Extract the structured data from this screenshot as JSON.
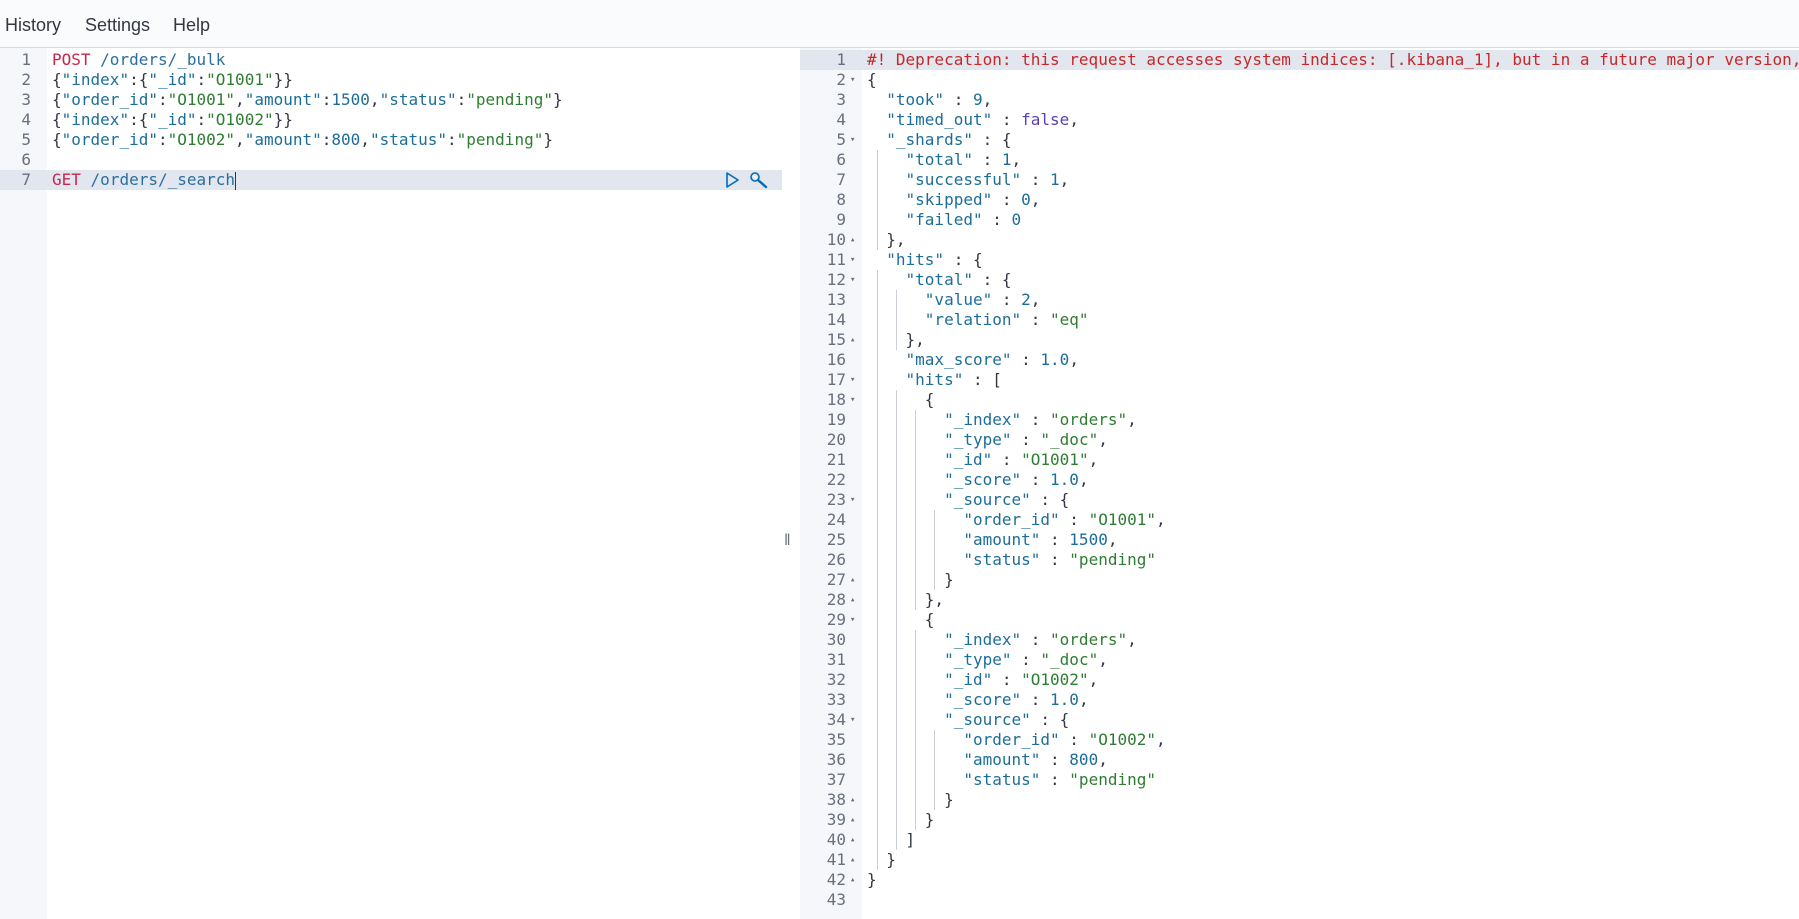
{
  "menu": {
    "history": "History",
    "settings": "Settings",
    "help": "Help"
  },
  "request_editor": {
    "lines": [
      {
        "n": "1",
        "tokens": [
          {
            "t": "POST",
            "c": "method"
          },
          {
            "t": " ",
            "c": "punc"
          },
          {
            "t": "/orders/_bulk",
            "c": "url"
          }
        ]
      },
      {
        "n": "2",
        "tokens": [
          {
            "t": "{",
            "c": "punc"
          },
          {
            "t": "\"index\"",
            "c": "key"
          },
          {
            "t": ":{",
            "c": "punc"
          },
          {
            "t": "\"_id\"",
            "c": "key"
          },
          {
            "t": ":",
            "c": "punc"
          },
          {
            "t": "\"O1001\"",
            "c": "str"
          },
          {
            "t": "}}",
            "c": "punc"
          }
        ]
      },
      {
        "n": "3",
        "tokens": [
          {
            "t": "{",
            "c": "punc"
          },
          {
            "t": "\"order_id\"",
            "c": "key"
          },
          {
            "t": ":",
            "c": "punc"
          },
          {
            "t": "\"O1001\"",
            "c": "str"
          },
          {
            "t": ",",
            "c": "punc"
          },
          {
            "t": "\"amount\"",
            "c": "key"
          },
          {
            "t": ":",
            "c": "punc"
          },
          {
            "t": "1500",
            "c": "num"
          },
          {
            "t": ",",
            "c": "punc"
          },
          {
            "t": "\"status\"",
            "c": "key"
          },
          {
            "t": ":",
            "c": "punc"
          },
          {
            "t": "\"pending\"",
            "c": "str"
          },
          {
            "t": "}",
            "c": "punc"
          }
        ]
      },
      {
        "n": "4",
        "tokens": [
          {
            "t": "{",
            "c": "punc"
          },
          {
            "t": "\"index\"",
            "c": "key"
          },
          {
            "t": ":{",
            "c": "punc"
          },
          {
            "t": "\"_id\"",
            "c": "key"
          },
          {
            "t": ":",
            "c": "punc"
          },
          {
            "t": "\"O1002\"",
            "c": "str"
          },
          {
            "t": "}}",
            "c": "punc"
          }
        ]
      },
      {
        "n": "5",
        "tokens": [
          {
            "t": "{",
            "c": "punc"
          },
          {
            "t": "\"order_id\"",
            "c": "key"
          },
          {
            "t": ":",
            "c": "punc"
          },
          {
            "t": "\"O1002\"",
            "c": "str"
          },
          {
            "t": ",",
            "c": "punc"
          },
          {
            "t": "\"amount\"",
            "c": "key"
          },
          {
            "t": ":",
            "c": "punc"
          },
          {
            "t": "800",
            "c": "num"
          },
          {
            "t": ",",
            "c": "punc"
          },
          {
            "t": "\"status\"",
            "c": "key"
          },
          {
            "t": ":",
            "c": "punc"
          },
          {
            "t": "\"pending\"",
            "c": "str"
          },
          {
            "t": "}",
            "c": "punc"
          }
        ]
      },
      {
        "n": "6",
        "tokens": []
      },
      {
        "n": "7",
        "tokens": [
          {
            "t": "GET",
            "c": "method"
          },
          {
            "t": " ",
            "c": "punc"
          },
          {
            "t": "/orders/_search",
            "c": "url"
          }
        ]
      }
    ],
    "active_line": "7",
    "actions": {
      "run_icon": "play-icon",
      "settings_icon": "wrench-icon"
    }
  },
  "response_viewer": {
    "lines": [
      {
        "n": "1",
        "fold": "",
        "tokens": [
          {
            "t": "#! Deprecation: this request accesses system indices: [.kibana_1], but in a future major version,",
            "c": "comment"
          }
        ]
      },
      {
        "n": "2",
        "fold": "▾",
        "tokens": [
          {
            "t": "{",
            "c": "punc"
          }
        ]
      },
      {
        "n": "3",
        "fold": "",
        "tokens": [
          {
            "t": "  ",
            "c": "punc"
          },
          {
            "t": "\"took\"",
            "c": "key"
          },
          {
            "t": " : ",
            "c": "punc"
          },
          {
            "t": "9",
            "c": "num"
          },
          {
            "t": ",",
            "c": "punc"
          }
        ]
      },
      {
        "n": "4",
        "fold": "",
        "tokens": [
          {
            "t": "  ",
            "c": "punc"
          },
          {
            "t": "\"timed_out\"",
            "c": "key"
          },
          {
            "t": " : ",
            "c": "punc"
          },
          {
            "t": "false",
            "c": "bool"
          },
          {
            "t": ",",
            "c": "punc"
          }
        ]
      },
      {
        "n": "5",
        "fold": "▾",
        "tokens": [
          {
            "t": "  ",
            "c": "punc"
          },
          {
            "t": "\"_shards\"",
            "c": "key"
          },
          {
            "t": " : {",
            "c": "punc"
          }
        ]
      },
      {
        "n": "6",
        "fold": "",
        "tokens": [
          {
            "t": "    ",
            "c": "punc"
          },
          {
            "t": "\"total\"",
            "c": "key"
          },
          {
            "t": " : ",
            "c": "punc"
          },
          {
            "t": "1",
            "c": "num"
          },
          {
            "t": ",",
            "c": "punc"
          }
        ]
      },
      {
        "n": "7",
        "fold": "",
        "tokens": [
          {
            "t": "    ",
            "c": "punc"
          },
          {
            "t": "\"successful\"",
            "c": "key"
          },
          {
            "t": " : ",
            "c": "punc"
          },
          {
            "t": "1",
            "c": "num"
          },
          {
            "t": ",",
            "c": "punc"
          }
        ]
      },
      {
        "n": "8",
        "fold": "",
        "tokens": [
          {
            "t": "    ",
            "c": "punc"
          },
          {
            "t": "\"skipped\"",
            "c": "key"
          },
          {
            "t": " : ",
            "c": "punc"
          },
          {
            "t": "0",
            "c": "num"
          },
          {
            "t": ",",
            "c": "punc"
          }
        ]
      },
      {
        "n": "9",
        "fold": "",
        "tokens": [
          {
            "t": "    ",
            "c": "punc"
          },
          {
            "t": "\"failed\"",
            "c": "key"
          },
          {
            "t": " : ",
            "c": "punc"
          },
          {
            "t": "0",
            "c": "num"
          }
        ]
      },
      {
        "n": "10",
        "fold": "▴",
        "tokens": [
          {
            "t": "  },",
            "c": "punc"
          }
        ]
      },
      {
        "n": "11",
        "fold": "▾",
        "tokens": [
          {
            "t": "  ",
            "c": "punc"
          },
          {
            "t": "\"hits\"",
            "c": "key"
          },
          {
            "t": " : {",
            "c": "punc"
          }
        ]
      },
      {
        "n": "12",
        "fold": "▾",
        "tokens": [
          {
            "t": "    ",
            "c": "punc"
          },
          {
            "t": "\"total\"",
            "c": "key"
          },
          {
            "t": " : {",
            "c": "punc"
          }
        ]
      },
      {
        "n": "13",
        "fold": "",
        "tokens": [
          {
            "t": "      ",
            "c": "punc"
          },
          {
            "t": "\"value\"",
            "c": "key"
          },
          {
            "t": " : ",
            "c": "punc"
          },
          {
            "t": "2",
            "c": "num"
          },
          {
            "t": ",",
            "c": "punc"
          }
        ]
      },
      {
        "n": "14",
        "fold": "",
        "tokens": [
          {
            "t": "      ",
            "c": "punc"
          },
          {
            "t": "\"relation\"",
            "c": "key"
          },
          {
            "t": " : ",
            "c": "punc"
          },
          {
            "t": "\"eq\"",
            "c": "str"
          }
        ]
      },
      {
        "n": "15",
        "fold": "▴",
        "tokens": [
          {
            "t": "    },",
            "c": "punc"
          }
        ]
      },
      {
        "n": "16",
        "fold": "",
        "tokens": [
          {
            "t": "    ",
            "c": "punc"
          },
          {
            "t": "\"max_score\"",
            "c": "key"
          },
          {
            "t": " : ",
            "c": "punc"
          },
          {
            "t": "1.0",
            "c": "num"
          },
          {
            "t": ",",
            "c": "punc"
          }
        ]
      },
      {
        "n": "17",
        "fold": "▾",
        "tokens": [
          {
            "t": "    ",
            "c": "punc"
          },
          {
            "t": "\"hits\"",
            "c": "key"
          },
          {
            "t": " : [",
            "c": "punc"
          }
        ]
      },
      {
        "n": "18",
        "fold": "▾",
        "tokens": [
          {
            "t": "      {",
            "c": "punc"
          }
        ]
      },
      {
        "n": "19",
        "fold": "",
        "tokens": [
          {
            "t": "        ",
            "c": "punc"
          },
          {
            "t": "\"_index\"",
            "c": "key"
          },
          {
            "t": " : ",
            "c": "punc"
          },
          {
            "t": "\"orders\"",
            "c": "str"
          },
          {
            "t": ",",
            "c": "punc"
          }
        ]
      },
      {
        "n": "20",
        "fold": "",
        "tokens": [
          {
            "t": "        ",
            "c": "punc"
          },
          {
            "t": "\"_type\"",
            "c": "key"
          },
          {
            "t": " : ",
            "c": "punc"
          },
          {
            "t": "\"_doc\"",
            "c": "str"
          },
          {
            "t": ",",
            "c": "punc"
          }
        ]
      },
      {
        "n": "21",
        "fold": "",
        "tokens": [
          {
            "t": "        ",
            "c": "punc"
          },
          {
            "t": "\"_id\"",
            "c": "key"
          },
          {
            "t": " : ",
            "c": "punc"
          },
          {
            "t": "\"O1001\"",
            "c": "str"
          },
          {
            "t": ",",
            "c": "punc"
          }
        ]
      },
      {
        "n": "22",
        "fold": "",
        "tokens": [
          {
            "t": "        ",
            "c": "punc"
          },
          {
            "t": "\"_score\"",
            "c": "key"
          },
          {
            "t": " : ",
            "c": "punc"
          },
          {
            "t": "1.0",
            "c": "num"
          },
          {
            "t": ",",
            "c": "punc"
          }
        ]
      },
      {
        "n": "23",
        "fold": "▾",
        "tokens": [
          {
            "t": "        ",
            "c": "punc"
          },
          {
            "t": "\"_source\"",
            "c": "key"
          },
          {
            "t": " : {",
            "c": "punc"
          }
        ]
      },
      {
        "n": "24",
        "fold": "",
        "tokens": [
          {
            "t": "          ",
            "c": "punc"
          },
          {
            "t": "\"order_id\"",
            "c": "key"
          },
          {
            "t": " : ",
            "c": "punc"
          },
          {
            "t": "\"O1001\"",
            "c": "str"
          },
          {
            "t": ",",
            "c": "punc"
          }
        ]
      },
      {
        "n": "25",
        "fold": "",
        "tokens": [
          {
            "t": "          ",
            "c": "punc"
          },
          {
            "t": "\"amount\"",
            "c": "key"
          },
          {
            "t": " : ",
            "c": "punc"
          },
          {
            "t": "1500",
            "c": "num"
          },
          {
            "t": ",",
            "c": "punc"
          }
        ]
      },
      {
        "n": "26",
        "fold": "",
        "tokens": [
          {
            "t": "          ",
            "c": "punc"
          },
          {
            "t": "\"status\"",
            "c": "key"
          },
          {
            "t": " : ",
            "c": "punc"
          },
          {
            "t": "\"pending\"",
            "c": "str"
          }
        ]
      },
      {
        "n": "27",
        "fold": "▴",
        "tokens": [
          {
            "t": "        }",
            "c": "punc"
          }
        ]
      },
      {
        "n": "28",
        "fold": "▴",
        "tokens": [
          {
            "t": "      },",
            "c": "punc"
          }
        ]
      },
      {
        "n": "29",
        "fold": "▾",
        "tokens": [
          {
            "t": "      {",
            "c": "punc"
          }
        ]
      },
      {
        "n": "30",
        "fold": "",
        "tokens": [
          {
            "t": "        ",
            "c": "punc"
          },
          {
            "t": "\"_index\"",
            "c": "key"
          },
          {
            "t": " : ",
            "c": "punc"
          },
          {
            "t": "\"orders\"",
            "c": "str"
          },
          {
            "t": ",",
            "c": "punc"
          }
        ]
      },
      {
        "n": "31",
        "fold": "",
        "tokens": [
          {
            "t": "        ",
            "c": "punc"
          },
          {
            "t": "\"_type\"",
            "c": "key"
          },
          {
            "t": " : ",
            "c": "punc"
          },
          {
            "t": "\"_doc\"",
            "c": "str"
          },
          {
            "t": ",",
            "c": "punc"
          }
        ]
      },
      {
        "n": "32",
        "fold": "",
        "tokens": [
          {
            "t": "        ",
            "c": "punc"
          },
          {
            "t": "\"_id\"",
            "c": "key"
          },
          {
            "t": " : ",
            "c": "punc"
          },
          {
            "t": "\"O1002\"",
            "c": "str"
          },
          {
            "t": ",",
            "c": "punc"
          }
        ]
      },
      {
        "n": "33",
        "fold": "",
        "tokens": [
          {
            "t": "        ",
            "c": "punc"
          },
          {
            "t": "\"_score\"",
            "c": "key"
          },
          {
            "t": " : ",
            "c": "punc"
          },
          {
            "t": "1.0",
            "c": "num"
          },
          {
            "t": ",",
            "c": "punc"
          }
        ]
      },
      {
        "n": "34",
        "fold": "▾",
        "tokens": [
          {
            "t": "        ",
            "c": "punc"
          },
          {
            "t": "\"_source\"",
            "c": "key"
          },
          {
            "t": " : {",
            "c": "punc"
          }
        ]
      },
      {
        "n": "35",
        "fold": "",
        "tokens": [
          {
            "t": "          ",
            "c": "punc"
          },
          {
            "t": "\"order_id\"",
            "c": "key"
          },
          {
            "t": " : ",
            "c": "punc"
          },
          {
            "t": "\"O1002\"",
            "c": "str"
          },
          {
            "t": ",",
            "c": "punc"
          }
        ]
      },
      {
        "n": "36",
        "fold": "",
        "tokens": [
          {
            "t": "          ",
            "c": "punc"
          },
          {
            "t": "\"amount\"",
            "c": "key"
          },
          {
            "t": " : ",
            "c": "punc"
          },
          {
            "t": "800",
            "c": "num"
          },
          {
            "t": ",",
            "c": "punc"
          }
        ]
      },
      {
        "n": "37",
        "fold": "",
        "tokens": [
          {
            "t": "          ",
            "c": "punc"
          },
          {
            "t": "\"status\"",
            "c": "key"
          },
          {
            "t": " : ",
            "c": "punc"
          },
          {
            "t": "\"pending\"",
            "c": "str"
          }
        ]
      },
      {
        "n": "38",
        "fold": "▴",
        "tokens": [
          {
            "t": "        }",
            "c": "punc"
          }
        ]
      },
      {
        "n": "39",
        "fold": "▴",
        "tokens": [
          {
            "t": "      }",
            "c": "punc"
          }
        ]
      },
      {
        "n": "40",
        "fold": "▴",
        "tokens": [
          {
            "t": "    ]",
            "c": "punc"
          }
        ]
      },
      {
        "n": "41",
        "fold": "▴",
        "tokens": [
          {
            "t": "  }",
            "c": "punc"
          }
        ]
      },
      {
        "n": "42",
        "fold": "▴",
        "tokens": [
          {
            "t": "}",
            "c": "punc"
          }
        ]
      },
      {
        "n": "43",
        "fold": "",
        "tokens": []
      }
    ],
    "active_line": "1"
  },
  "resizer": "‖",
  "colors": {
    "method": "#c7254e",
    "url": "#2b6f9e",
    "key": "#1c6e99",
    "string": "#2f7d32",
    "comment": "#c62828",
    "bool": "#5b3fb8",
    "highlight": "#e1e6ef"
  }
}
